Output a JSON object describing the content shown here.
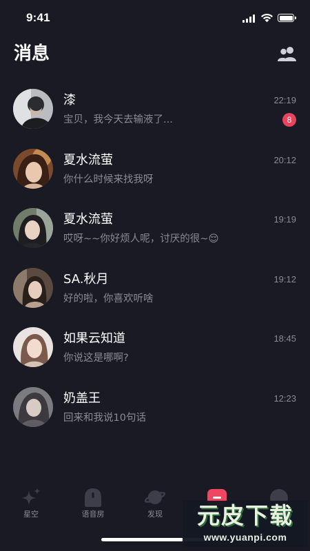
{
  "status_bar": {
    "time": "9:41"
  },
  "header": {
    "title": "消息",
    "contacts_icon": "contacts-icon"
  },
  "conversations": [
    {
      "name": "漆",
      "preview": "宝贝，我今天去输液了...",
      "time": "22:19",
      "unread": "8",
      "avatar": "avatar-photo"
    },
    {
      "name": "夏水流萤",
      "preview": "你什么时候来找我呀",
      "time": "20:12",
      "avatar": "avatar-photo"
    },
    {
      "name": "夏水流萤",
      "preview": "哎呀~~你好烦人呢，讨厌的很~😌",
      "time": "19:19",
      "avatar": "avatar-photo"
    },
    {
      "name": "SA.秋月",
      "preview": "好的啦，你喜欢听啥",
      "time": "19:12",
      "avatar": "avatar-photo"
    },
    {
      "name": "如果云知道",
      "preview": "你说这是哪啊?",
      "time": "18:45",
      "avatar": "avatar-photo"
    },
    {
      "name": "奶盖王",
      "preview": "回来和我说10句话",
      "time": "12:23",
      "avatar": "avatar-photo"
    }
  ],
  "tab_bar": {
    "tabs": [
      {
        "label": "星空",
        "icon": "sparkle-icon"
      },
      {
        "label": "语音房",
        "icon": "voice-room-icon"
      },
      {
        "label": "发现",
        "icon": "planet-icon"
      },
      {
        "label": "",
        "icon": "message-icon",
        "active": true
      },
      {
        "label": "",
        "icon": "profile-icon"
      }
    ]
  },
  "watermark": {
    "logo_text": "元皮下载",
    "url": "www.yuanpi.com"
  },
  "colors": {
    "background": "#191a24",
    "text_primary": "#ffffff",
    "text_secondary": "#8a8b96",
    "badge": "#e8435d",
    "active_tab": "#f14661"
  }
}
